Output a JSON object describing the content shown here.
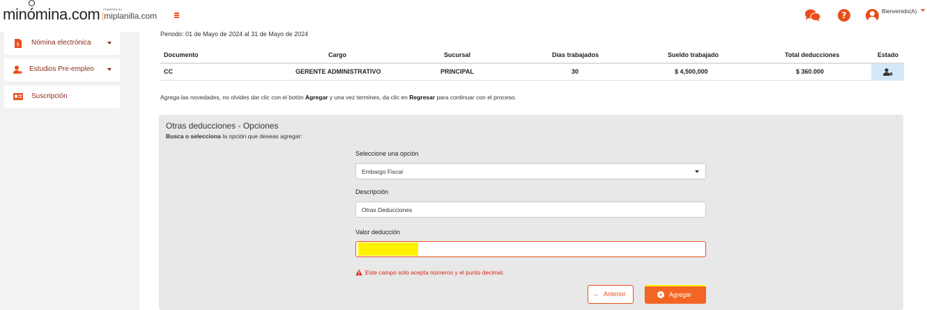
{
  "header": {
    "logo_text_1": "min",
    "logo_text_2": "mina.com",
    "logo_o": "ó",
    "powered_by": "POWERED BY",
    "miplanilla_bar": "|",
    "miplanilla": "miplanilla.com",
    "welcome": "Bienvenido(A)"
  },
  "sidebar": {
    "items": [
      {
        "label": "Nómina electrónica",
        "icon": "document-dollar-icon",
        "has_caret": true
      },
      {
        "label": "Estudios Pre-empleo",
        "icon": "user-plus-icon",
        "has_caret": true
      },
      {
        "label": "Suscripción",
        "icon": "id-card-icon",
        "has_caret": false
      }
    ]
  },
  "main": {
    "periodo": "Periodo: 01 de Mayo de 2024 al 31 de Mayo de 2024",
    "table": {
      "headers": [
        "Documento",
        "Cargo",
        "Sucursal",
        "Días trabajados",
        "Sueldo trabajado",
        "Total deducciones",
        "Estado"
      ],
      "row": {
        "documento": "CC",
        "cargo": "GERENTE ADMINISTRATIVO",
        "sucursal": "PRINCIPAL",
        "dias": "30",
        "sueldo": "$ 4,500,000",
        "deducciones": "$ 360.000"
      }
    },
    "instructions": {
      "part1": "Agrega las novedades, no olvides dar clic con el botón ",
      "bold1": "Agregar",
      "part2": " y una vez termines, da clic en ",
      "bold2": "Regresar",
      "part3": " para continuar con el proceso."
    },
    "panel": {
      "title": "Otras deducciones - Opciones",
      "sub_bold": "Busca o selecciona",
      "sub_rest": " la opción que deseas agregar:",
      "select_label": "Seleccione una opción",
      "select_value": "Embargo Fiscal",
      "desc_label": "Descripción",
      "desc_value": "Otras Deducciones",
      "valor_label": "Valor deducción",
      "valor_value": "",
      "error": "Este campo solo acepta números y el punto decimal.",
      "btn_prev": "Anterior",
      "btn_add": "Agregar"
    }
  },
  "colors": {
    "accent": "#e94e1b",
    "button": "#f26522",
    "sidebar_text": "#8b2b1a",
    "error": "#d9261c",
    "highlight": "#fff200"
  }
}
